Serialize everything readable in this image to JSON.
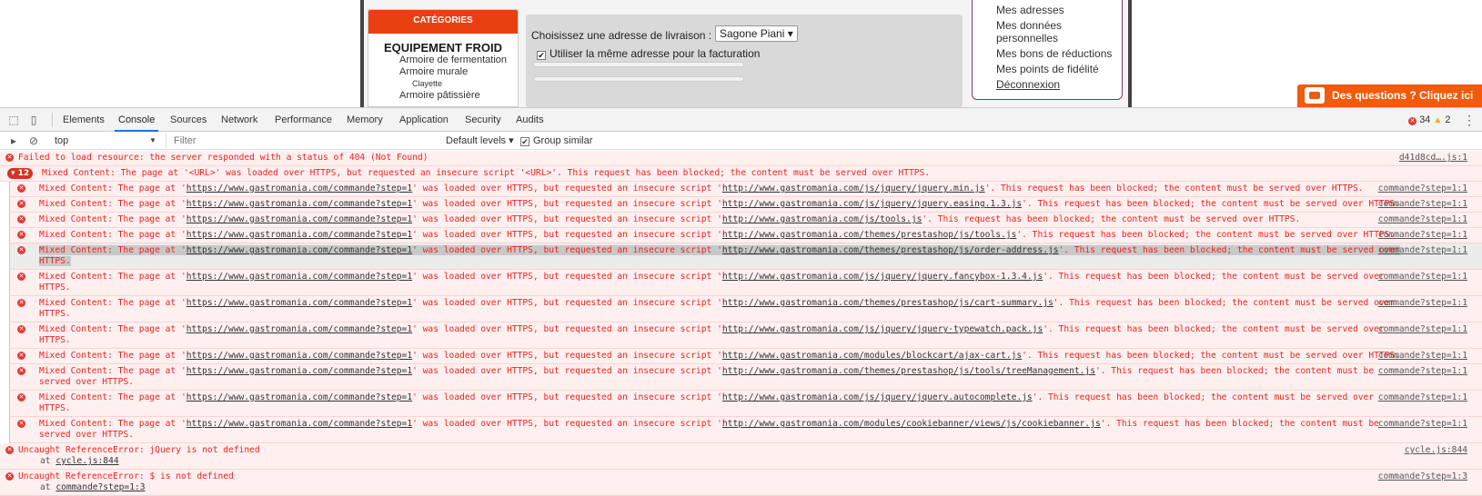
{
  "page": {
    "categories_header": "CATÉGORIES",
    "categories_title": "EQUIPEMENT FROID",
    "category_links": [
      "Armoire de fermentation",
      "Armoire murale"
    ],
    "category_sub": "Clayette",
    "category_more": "Armoire pâtissière",
    "delivery_label": "Choisissez une adresse de livraison :",
    "delivery_select": "Sagone Piani ▾",
    "same_address_label": "Utiliser la même adresse pour la facturation",
    "account_links": [
      "Mes adresses",
      "Mes données personnelles",
      "Mes bons de réductions",
      "Mes points de fidélité"
    ],
    "logout_link": "Déconnexion",
    "help_button": "Des questions ? Cliquez ici"
  },
  "devtools": {
    "tabs": [
      "Elements",
      "Console",
      "Sources",
      "Network",
      "Performance",
      "Memory",
      "Application",
      "Security",
      "Audits"
    ],
    "active_tab": "Console",
    "error_count": "34",
    "warning_count": "2",
    "context": "top",
    "filter_placeholder": "Filter",
    "levels_label": "Default levels ▾",
    "group_similar_label": "Group similar"
  },
  "console": {
    "first_error": {
      "text": "Failed to load resource: the server responded with a status of 404 (Not Found)",
      "source": "d41d8cd….js:1"
    },
    "group": {
      "badge": "▾ 12",
      "text": "Mixed Content: The page at '<URL>' was loaded over HTTPS, but requested an insecure script '<URL>'. This request has been blocked; the content must be served over HTTPS."
    },
    "mixed_prefix": "Mixed Content: The page at '",
    "page_url": "https://www.gastromania.com/commande?step=1",
    "mixed_middle": "' was loaded over HTTPS, but requested an insecure script '",
    "mixed_suffix": "'. This request has been blocked; the content must be served over HTTPS.",
    "mixed_source": "commande?step=1:1",
    "script_urls": [
      "http://www.gastromania.com/js/jquery/jquery.min.js",
      "http://www.gastromania.com/js/jquery/jquery.easing.1.3.js",
      "http://www.gastromania.com/js/tools.js",
      "http://www.gastromania.com/themes/prestashop/js/tools.js",
      "http://www.gastromania.com/themes/prestashop/js/order-address.js",
      "http://www.gastromania.com/js/jquery/jquery.fancybox-1.3.4.js",
      "http://www.gastromania.com/themes/prestashop/js/cart-summary.js",
      "http://www.gastromania.com/js/jquery/jquery-typewatch.pack.js",
      "http://www.gastromania.com/modules/blockcart/ajax-cart.js",
      "http://www.gastromania.com/themes/prestashop/js/tools/treeManagement.js",
      "http://www.gastromania.com/js/jquery/jquery.autocomplete.js",
      "http://www.gastromania.com/modules/cookiebanner/views/js/cookiebanner.js"
    ],
    "errors": [
      {
        "text": "Uncaught ReferenceError: jQuery is not defined",
        "at": "at ",
        "at_link": "cycle.js:844",
        "source": "cycle.js:844"
      },
      {
        "text": "Uncaught ReferenceError: $ is not defined",
        "at": "at ",
        "at_link": "commande?step=1:3",
        "source": "commande?step=1:3"
      }
    ]
  }
}
